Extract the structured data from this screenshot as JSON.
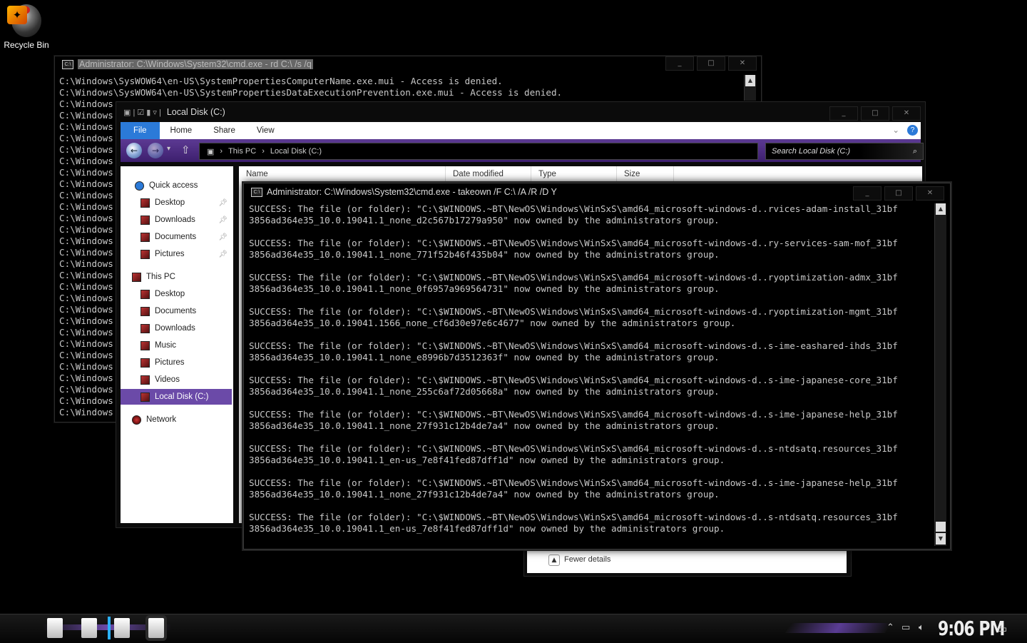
{
  "desktop": {
    "recycle_bin_label": "Recycle Bin"
  },
  "cmd_back": {
    "title": "Administrator: C:\\Windows\\System32\\cmd.exe - rd  C:\\ /s /q",
    "lines": [
      "C:\\Windows\\SysWOW64\\en-US\\SystemPropertiesComputerName.exe.mui - Access is denied.",
      "C:\\Windows\\SysWOW64\\en-US\\SystemPropertiesDataExecutionPrevention.exe.mui - Access is denied.",
      "C:\\Windows",
      "C:\\Windows",
      "C:\\Windows",
      "C:\\Windows",
      "C:\\Windows",
      "C:\\Windows",
      "C:\\Windows",
      "C:\\Windows",
      "C:\\Windows",
      "C:\\Windows",
      "C:\\Windows",
      "C:\\Windows",
      "C:\\Windows",
      "C:\\Windows",
      "C:\\Windows",
      "C:\\Windows",
      "C:\\Windows",
      "C:\\Windows",
      "C:\\Windows",
      "C:\\Windows",
      "C:\\Windows",
      "C:\\Windows",
      "C:\\Windows",
      "C:\\Windows",
      "C:\\Windows",
      "C:\\Windows",
      "C:\\Windows",
      "C:\\Windows"
    ],
    "cursor": "_"
  },
  "explorer": {
    "title": "Local Disk (C:)",
    "ribbon_tabs": [
      "File",
      "Home",
      "Share",
      "View"
    ],
    "breadcrumb": [
      "This PC",
      "Local Disk (C:)"
    ],
    "search_placeholder": "Search Local Disk (C:)",
    "columns": [
      "Name",
      "Date modified",
      "Type",
      "Size"
    ],
    "nav": [
      {
        "label": "Quick access",
        "pinned": false
      },
      {
        "label": "Desktop",
        "pinned": true
      },
      {
        "label": "Downloads",
        "pinned": true
      },
      {
        "label": "Documents",
        "pinned": true
      },
      {
        "label": "Pictures",
        "pinned": true
      },
      {
        "label": "This PC",
        "pinned": false
      },
      {
        "label": "Desktop",
        "pinned": false
      },
      {
        "label": "Documents",
        "pinned": false
      },
      {
        "label": "Downloads",
        "pinned": false
      },
      {
        "label": "Music",
        "pinned": false
      },
      {
        "label": "Pictures",
        "pinned": false
      },
      {
        "label": "Videos",
        "pinned": false
      },
      {
        "label": "Local Disk (C:)",
        "pinned": false,
        "selected": true
      },
      {
        "label": "Network",
        "pinned": false
      }
    ],
    "fewer_details": "Fewer details"
  },
  "cmd_front": {
    "title": "Administrator: C:\\Windows\\System32\\cmd.exe - takeown  /F C:\\ /A /R /D Y",
    "lines": [
      "SUCCESS: The file (or folder): \"C:\\$WINDOWS.~BT\\NewOS\\Windows\\WinSxS\\amd64_microsoft-windows-d..rvices-adam-install_31bf",
      "3856ad364e35_10.0.19041.1_none_d2c567b17279a950\" now owned by the administrators group.",
      "",
      "SUCCESS: The file (or folder): \"C:\\$WINDOWS.~BT\\NewOS\\Windows\\WinSxS\\amd64_microsoft-windows-d..ry-services-sam-mof_31bf",
      "3856ad364e35_10.0.19041.1_none_771f52b46f435b04\" now owned by the administrators group.",
      "",
      "SUCCESS: The file (or folder): \"C:\\$WINDOWS.~BT\\NewOS\\Windows\\WinSxS\\amd64_microsoft-windows-d..ryoptimization-admx_31bf",
      "3856ad364e35_10.0.19041.1_none_0f6957a969564731\" now owned by the administrators group.",
      "",
      "SUCCESS: The file (or folder): \"C:\\$WINDOWS.~BT\\NewOS\\Windows\\WinSxS\\amd64_microsoft-windows-d..ryoptimization-mgmt_31bf",
      "3856ad364e35_10.0.19041.1566_none_cf6d30e97e6c4677\" now owned by the administrators group.",
      "",
      "SUCCESS: The file (or folder): \"C:\\$WINDOWS.~BT\\NewOS\\Windows\\WinSxS\\amd64_microsoft-windows-d..s-ime-eashared-ihds_31bf",
      "3856ad364e35_10.0.19041.1_none_e8996b7d3512363f\" now owned by the administrators group.",
      "",
      "SUCCESS: The file (or folder): \"C:\\$WINDOWS.~BT\\NewOS\\Windows\\WinSxS\\amd64_microsoft-windows-d..s-ime-japanese-core_31bf",
      "3856ad364e35_10.0.19041.1_none_255c6af72d05668a\" now owned by the administrators group.",
      "",
      "SUCCESS: The file (or folder): \"C:\\$WINDOWS.~BT\\NewOS\\Windows\\WinSxS\\amd64_microsoft-windows-d..s-ime-japanese-help_31bf",
      "3856ad364e35_10.0.19041.1_none_27f931c12b4de7a4\" now owned by the administrators group.",
      "",
      "SUCCESS: The file (or folder): \"C:\\$WINDOWS.~BT\\NewOS\\Windows\\WinSxS\\amd64_microsoft-windows-d..s-ntdsatq.resources_31bf",
      "3856ad364e35_10.0.19041.1_en-us_7e8f41fed87dff1d\" now owned by the administrators group.",
      "",
      "SUCCESS: The file (or folder): \"C:\\$WINDOWS.~BT\\NewOS\\Windows\\WinSxS\\amd64_microsoft-windows-d..s-ime-japanese-help_31bf",
      "3856ad364e35_10.0.19041.1_none_27f931c12b4de7a4\" now owned by the administrators group.",
      "",
      "SUCCESS: The file (or folder): \"C:\\$WINDOWS.~BT\\NewOS\\Windows\\WinSxS\\amd64_microsoft-windows-d..s-ntdsatq.resources_31bf",
      "3856ad364e35_10.0.19041.1_en-us_7e8f41fed87dff1d\" now owned by the administrators group."
    ]
  },
  "taskbar": {
    "clock": "9:06 PM"
  },
  "colors": {
    "accent": "#6b4aa8",
    "file_tab": "#2b7ad8",
    "nav_gradient_top": "#5c3a93"
  }
}
